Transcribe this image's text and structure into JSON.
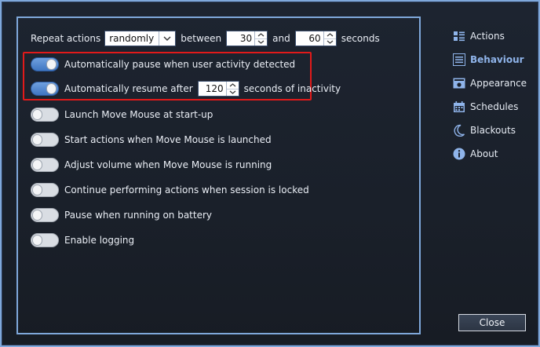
{
  "repeat_row": {
    "label_repeat": "Repeat actions",
    "mode_value": "randomly",
    "label_between": "between",
    "min_value": "30",
    "label_and": "and",
    "max_value": "60",
    "label_seconds": "seconds"
  },
  "options": [
    {
      "label": "Automatically pause when user activity detected",
      "on": true
    },
    {
      "label_before": "Automatically resume after",
      "value": "120",
      "label_after": "seconds of inactivity",
      "on": true
    },
    {
      "label": "Launch Move Mouse at start-up",
      "on": false
    },
    {
      "label": "Start actions when Move Mouse is launched",
      "on": false
    },
    {
      "label": "Adjust volume when Move Mouse is running",
      "on": false
    },
    {
      "label": "Continue performing actions when session is locked",
      "on": false
    },
    {
      "label": "Pause when running on battery",
      "on": false
    },
    {
      "label": "Enable logging",
      "on": false
    }
  ],
  "sidebar": {
    "items": [
      {
        "label": "Actions",
        "icon": "actions-list-icon"
      },
      {
        "label": "Behaviour",
        "icon": "behaviour-list-icon",
        "active": true
      },
      {
        "label": "Appearance",
        "icon": "appearance-icon"
      },
      {
        "label": "Schedules",
        "icon": "calendar-icon"
      },
      {
        "label": "Blackouts",
        "icon": "moon-icon"
      },
      {
        "label": "About",
        "icon": "info-icon"
      }
    ]
  },
  "close_label": "Close",
  "colors": {
    "accent": "#7fa8db",
    "highlight": "#e11a1a",
    "toggle_on": "#4f86d1",
    "background": "#1b212b"
  }
}
